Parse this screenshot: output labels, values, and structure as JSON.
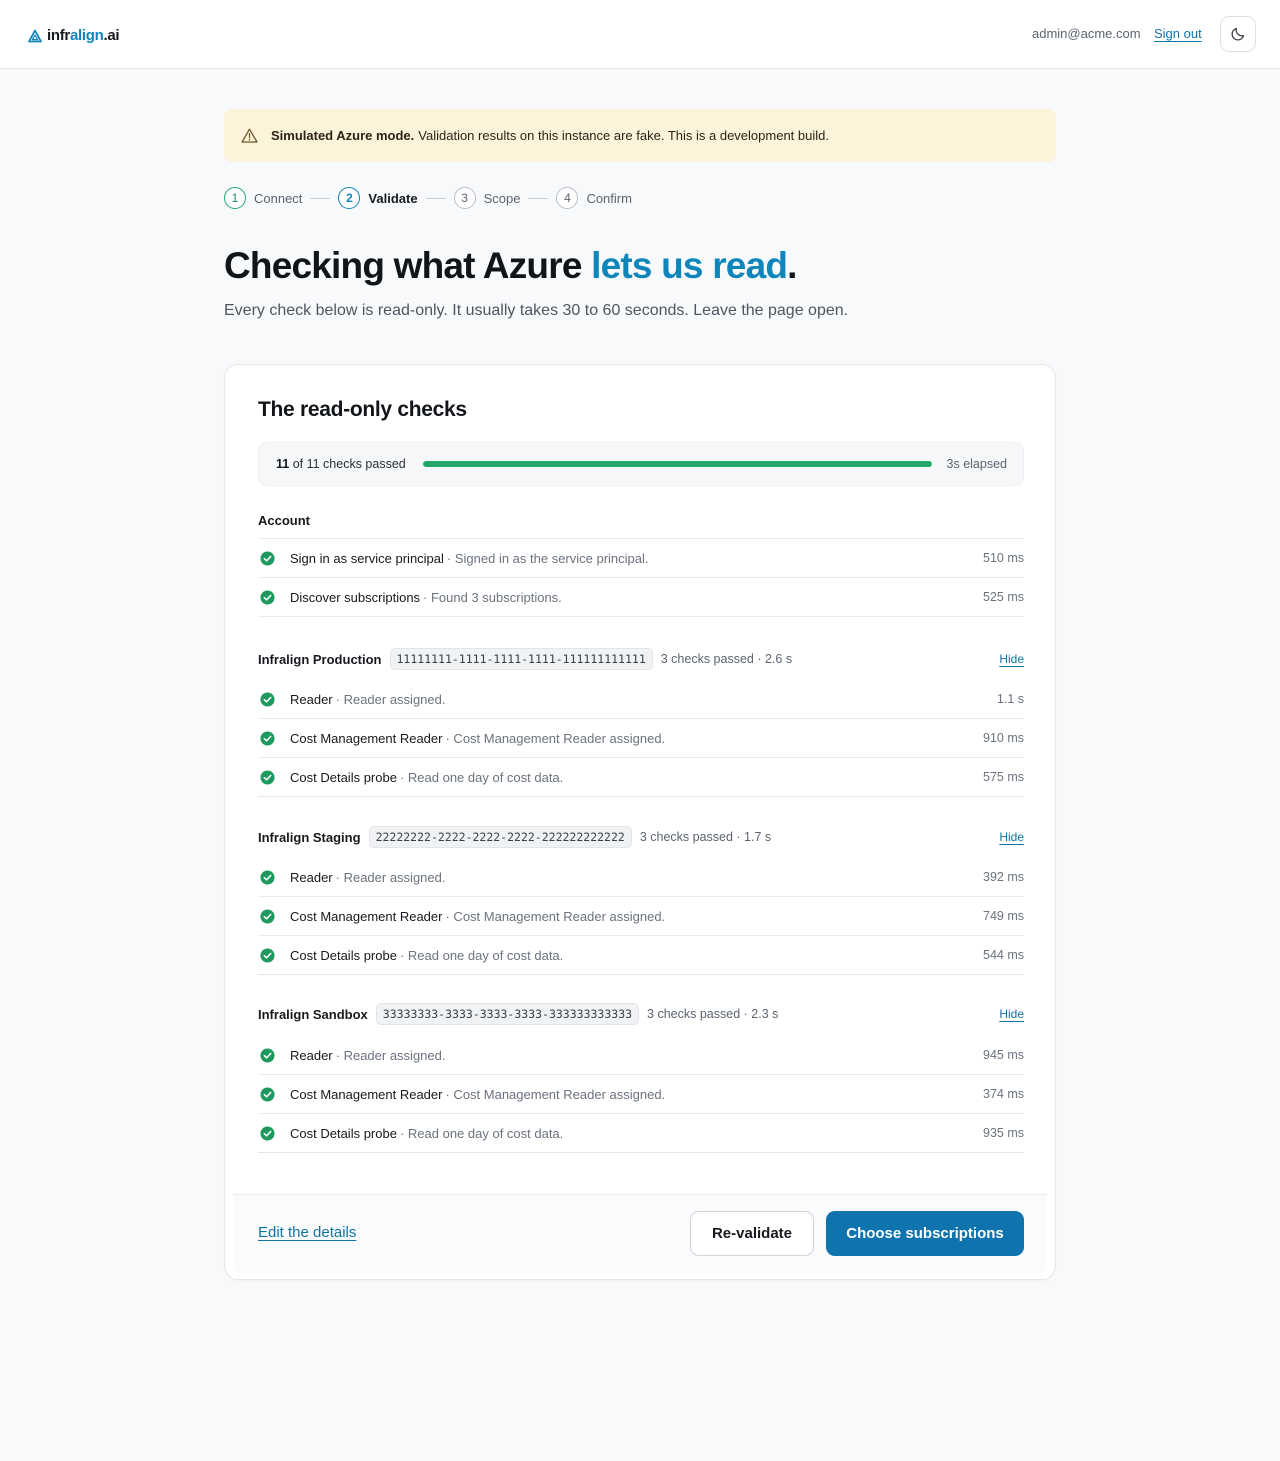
{
  "header": {
    "brand_part1": "infr",
    "brand_part2": "align",
    "brand_part3": ".ai",
    "user_email": "admin@acme.com",
    "sign_out": "Sign out",
    "theme_icon": "moon-icon"
  },
  "banner": {
    "strong": "Simulated Azure mode.",
    "text": "Validation results on this instance are fake. This is a development build.",
    "icon": "warning-icon"
  },
  "stepper": [
    {
      "num": "1",
      "label": "Connect",
      "state": "done"
    },
    {
      "num": "2",
      "label": "Validate",
      "state": "active"
    },
    {
      "num": "3",
      "label": "Scope",
      "state": "pending"
    },
    {
      "num": "4",
      "label": "Confirm",
      "state": "pending"
    }
  ],
  "hero": {
    "title_start": "Checking what Azure ",
    "title_accent": "lets us read",
    "title_end": ".",
    "subtitle": "Every check below is read-only. It usually takes 30 to 60 seconds. Leave the page open."
  },
  "card": {
    "title": "The read-only checks",
    "progress": {
      "passed": "11",
      "label_rest": " of 11 checks passed",
      "elapsed": "3s elapsed",
      "fraction": 1.0
    },
    "account": {
      "title": "Account",
      "rows": [
        {
          "name": "Sign in as service principal",
          "desc": "· Signed in as the service principal.",
          "time": "510 ms"
        },
        {
          "name": "Discover subscriptions",
          "desc": "· Found 3 subscriptions.",
          "time": "525 ms"
        }
      ]
    },
    "subscriptions": [
      {
        "name": "Infralign Production",
        "id": "11111111-1111-1111-1111-111111111111",
        "meta": "3 checks passed · 2.6 s",
        "hide": "Hide",
        "rows": [
          {
            "name": "Reader",
            "desc": "· Reader assigned.",
            "time": "1.1 s"
          },
          {
            "name": "Cost Management Reader",
            "desc": "· Cost Management Reader assigned.",
            "time": "910 ms"
          },
          {
            "name": "Cost Details probe",
            "desc": "· Read one day of cost data.",
            "time": "575 ms"
          }
        ]
      },
      {
        "name": "Infralign Staging",
        "id": "22222222-2222-2222-2222-222222222222",
        "meta": "3 checks passed · 1.7 s",
        "hide": "Hide",
        "rows": [
          {
            "name": "Reader",
            "desc": "· Reader assigned.",
            "time": "392 ms"
          },
          {
            "name": "Cost Management Reader",
            "desc": "· Cost Management Reader assigned.",
            "time": "749 ms"
          },
          {
            "name": "Cost Details probe",
            "desc": "· Read one day of cost data.",
            "time": "544 ms"
          }
        ]
      },
      {
        "name": "Infralign Sandbox",
        "id": "33333333-3333-3333-3333-333333333333",
        "meta": "3 checks passed · 2.3 s",
        "hide": "Hide",
        "rows": [
          {
            "name": "Reader",
            "desc": "· Reader assigned.",
            "time": "945 ms"
          },
          {
            "name": "Cost Management Reader",
            "desc": "· Cost Management Reader assigned.",
            "time": "374 ms"
          },
          {
            "name": "Cost Details probe",
            "desc": "· Read one day of cost data.",
            "time": "935 ms"
          }
        ]
      }
    ],
    "footer": {
      "edit": "Edit the details",
      "revalidate": "Re-validate",
      "choose": "Choose subscriptions"
    }
  },
  "colors": {
    "accent": "#0f86bb",
    "success": "#22a66a",
    "banner_bg": "#fdf3da",
    "primary_button": "#0f73ad"
  }
}
